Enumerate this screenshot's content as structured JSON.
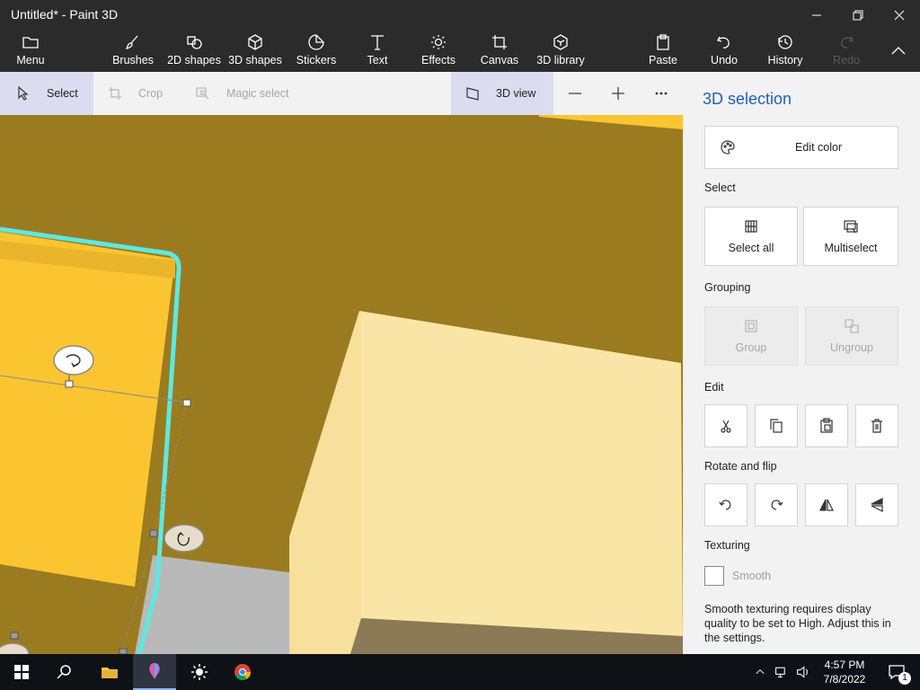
{
  "window": {
    "title": "Untitled* - Paint 3D"
  },
  "ribbon": {
    "menu": "Menu",
    "brushes": "Brushes",
    "shapes2d": "2D shapes",
    "shapes3d": "3D shapes",
    "stickers": "Stickers",
    "text": "Text",
    "effects": "Effects",
    "canvas": "Canvas",
    "library3d": "3D library",
    "paste": "Paste",
    "undo": "Undo",
    "history": "History",
    "redo": "Redo"
  },
  "toolbar": {
    "select": "Select",
    "crop": "Crop",
    "magic_select": "Magic select",
    "view3d": "3D view"
  },
  "panel": {
    "title": "3D selection",
    "edit_color": "Edit color",
    "select_heading": "Select",
    "select_all": "Select all",
    "multiselect": "Multiselect",
    "grouping_heading": "Grouping",
    "group": "Group",
    "ungroup": "Ungroup",
    "edit_heading": "Edit",
    "rotate_heading": "Rotate and flip",
    "texturing_heading": "Texturing",
    "smooth": "Smooth",
    "smooth_checked": false,
    "hint": "Smooth texturing requires display quality to be set to High. Adjust this in the settings."
  },
  "taskbar": {
    "time": "4:57 PM",
    "date": "7/8/2022",
    "notification_count": "1"
  },
  "colors": {
    "accent": "#1f5fbf",
    "canvas_bg": "#9b7b1f",
    "selection_outline": "#5ee8e0",
    "yellow_object": "#fbc531",
    "cream_object": "#f9e6a6"
  }
}
